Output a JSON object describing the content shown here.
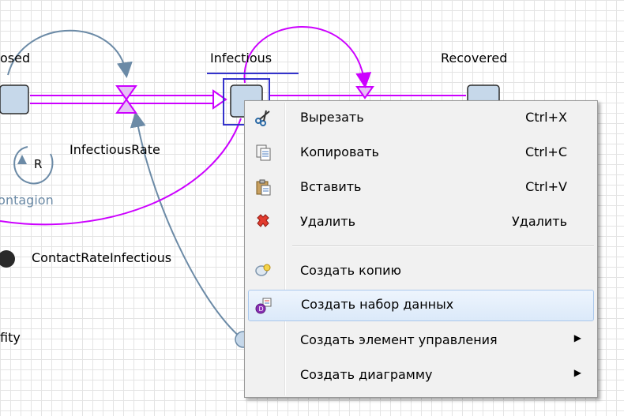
{
  "diagram": {
    "exposed_label": "osed",
    "infectious_label": "Infectious",
    "recovered_label": "Recovered",
    "infectious_rate_label": "InfectiousRate",
    "loop_marker": "R",
    "loop_label": "Contagion",
    "contact_rate_label": "ContactRateInfectious",
    "fity_label": "fity"
  },
  "context_menu": {
    "items": [
      {
        "label": "Вырезать",
        "shortcut": "Ctrl+X",
        "icon": "scissors-icon"
      },
      {
        "label": "Копировать",
        "shortcut": "Ctrl+C",
        "icon": "copy-icon"
      },
      {
        "label": "Вставить",
        "shortcut": "Ctrl+V",
        "icon": "paste-icon"
      },
      {
        "label": "Удалить",
        "shortcut": "Удалить",
        "icon": "delete-icon"
      },
      {
        "label": "Создать копию",
        "icon": "duplicate-icon"
      },
      {
        "label": "Создать набор данных",
        "icon": "dataset-icon"
      },
      {
        "label": "Создать элемент управления",
        "submenu_arrow": "▶"
      },
      {
        "label": "Создать диаграмму",
        "submenu_arrow": "▶"
      }
    ]
  },
  "colors": {
    "flow": "#cc00ff",
    "link": "#6b8aa6",
    "stock_fill": "#c6d8ea",
    "highlight": "#3333cc"
  }
}
